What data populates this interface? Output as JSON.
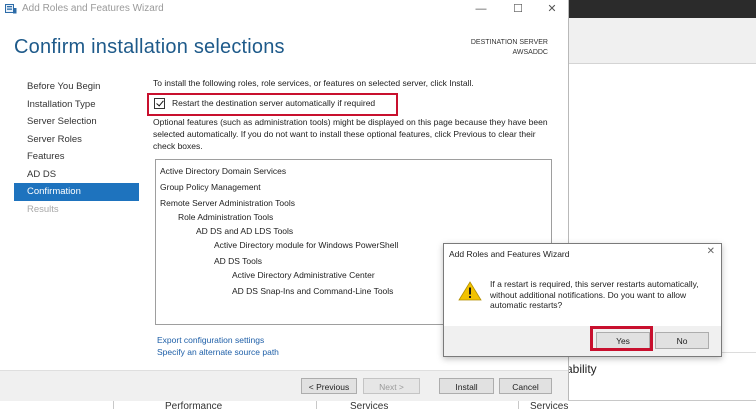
{
  "window": {
    "title": "Add Roles and Features Wizard",
    "minimize": "—",
    "maximize": "☐",
    "close": "✕"
  },
  "header": {
    "page_title": "Confirm installation selections",
    "destination_label": "DESTINATION SERVER",
    "destination_name": "AWSADDC"
  },
  "nav": {
    "items": [
      {
        "label": "Before You Begin",
        "state": "normal"
      },
      {
        "label": "Installation Type",
        "state": "normal"
      },
      {
        "label": "Server Selection",
        "state": "normal"
      },
      {
        "label": "Server Roles",
        "state": "normal"
      },
      {
        "label": "Features",
        "state": "normal"
      },
      {
        "label": "AD DS",
        "state": "normal"
      },
      {
        "label": "Confirmation",
        "state": "active"
      },
      {
        "label": "Results",
        "state": "disabled"
      }
    ]
  },
  "main": {
    "intro": "To install the following roles, role services, or features on selected server, click Install.",
    "restart_checkbox_label": "Restart the destination server automatically if required",
    "restart_checked": true,
    "optional_text": "Optional features (such as administration tools) might be displayed on this page because they have been selected automatically. If you do not want to install these optional features, click Previous to clear their check boxes.",
    "features": [
      {
        "label": "Active Directory Domain Services",
        "level": 0
      },
      {
        "label": "Group Policy Management",
        "level": 0
      },
      {
        "label": "Remote Server Administration Tools",
        "level": 0
      },
      {
        "label": "Role Administration Tools",
        "level": 1
      },
      {
        "label": "AD DS and AD LDS Tools",
        "level": 2
      },
      {
        "label": "Active Directory module for Windows PowerShell",
        "level": 3
      },
      {
        "label": "AD DS Tools",
        "level": 3
      },
      {
        "label": "Active Directory Administrative Center",
        "level": 4
      },
      {
        "label": "AD DS Snap-Ins and Command-Line Tools",
        "level": 4
      }
    ],
    "export_link": "Export configuration settings",
    "source_link": "Specify an alternate source path"
  },
  "footer": {
    "previous": "< Previous",
    "next": "Next >",
    "install": "Install",
    "cancel": "Cancel"
  },
  "dialog": {
    "title": "Add Roles and Features Wizard",
    "close": "✕",
    "message": "If a restart is required, this server restarts automatically, without additional notifications. Do you want to allow automatic restarts?",
    "yes": "Yes",
    "no": "No",
    "icon": "warning-icon"
  },
  "background": {
    "ability_text": "ability",
    "columns": [
      "Performance",
      "Services",
      "Services"
    ]
  },
  "colors": {
    "accent": "#1e73be",
    "title": "#1e5a8a",
    "highlight_box": "#c8102e",
    "link": "#1e5fa8"
  }
}
